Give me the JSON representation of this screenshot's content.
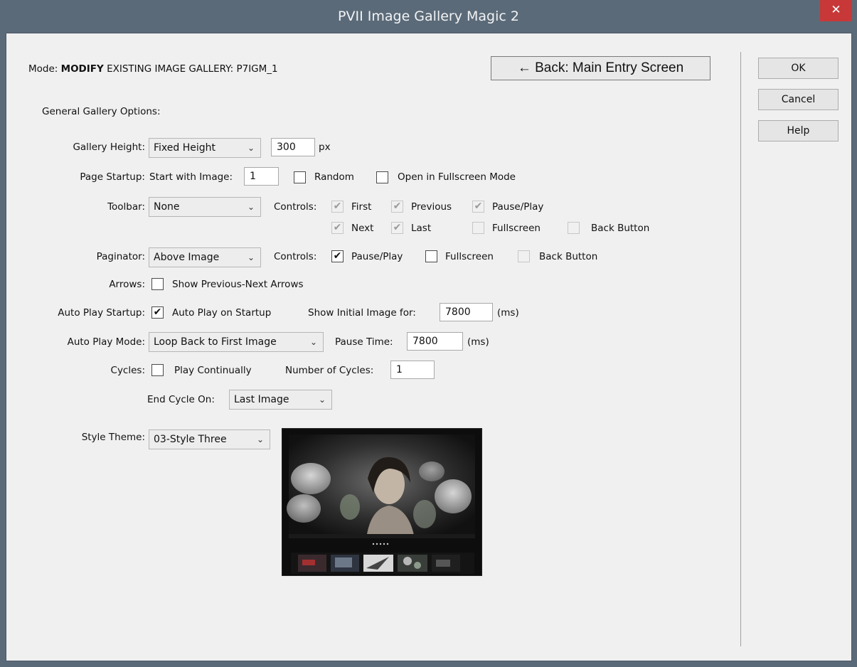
{
  "window": {
    "title": "PVII Image Gallery Magic 2",
    "close_glyph": "✕"
  },
  "mode": {
    "prefix": "Mode:",
    "value": "MODIFY",
    "suffix": "EXISTING IMAGE GALLERY: P7IGM_1"
  },
  "back_button": "← Back: Main Entry Screen",
  "side_buttons": {
    "ok": "OK",
    "cancel": "Cancel",
    "help": "Help"
  },
  "section_title": "General Gallery Options:",
  "gallery_height": {
    "label": "Gallery Height:",
    "select": "Fixed Height",
    "value": "300",
    "unit": "px"
  },
  "page_startup": {
    "label": "Page Startup:",
    "start_label": "Start with Image:",
    "start_value": "1",
    "random": "Random",
    "random_checked": false,
    "fullscreen": "Open in Fullscreen Mode",
    "fullscreen_checked": false
  },
  "toolbar": {
    "label": "Toolbar:",
    "select": "None",
    "controls_label": "Controls:",
    "first": "First",
    "previous": "Previous",
    "pause_play": "Pause/Play",
    "next": "Next",
    "last": "Last",
    "fullscreen": "Fullscreen",
    "back_button": "Back Button"
  },
  "paginator": {
    "label": "Paginator:",
    "select": "Above Image",
    "controls_label": "Controls:",
    "pause_play": "Pause/Play",
    "pause_play_checked": true,
    "fullscreen": "Fullscreen",
    "fullscreen_checked": false,
    "back_button": "Back Button"
  },
  "arrows": {
    "label": "Arrows:",
    "option": "Show Previous-Next Arrows",
    "checked": false
  },
  "auto_play_startup": {
    "label": "Auto Play Startup:",
    "option": "Auto Play on Startup",
    "checked": true,
    "initial_label": "Show Initial Image for:",
    "initial_value": "7800",
    "unit": "(ms)"
  },
  "auto_play_mode": {
    "label": "Auto Play Mode:",
    "select": "Loop Back to First Image",
    "pause_label": "Pause Time:",
    "pause_value": "7800",
    "unit": "(ms)"
  },
  "cycles": {
    "label": "Cycles:",
    "option": "Play Continually",
    "checked": false,
    "number_label": "Number of Cycles:",
    "number_value": "1"
  },
  "end_cycle": {
    "label": "End Cycle On:",
    "select": "Last Image"
  },
  "style_theme": {
    "label": "Style Theme:",
    "select": "03-Style Three"
  },
  "icons": {
    "dropdown": "chevron-down-icon",
    "check": "checkmark-icon",
    "close": "close-icon"
  },
  "colors": {
    "close_red": "#c83838",
    "titlebar": "#5b6a78",
    "dialog_bg": "#f0f0f0"
  }
}
